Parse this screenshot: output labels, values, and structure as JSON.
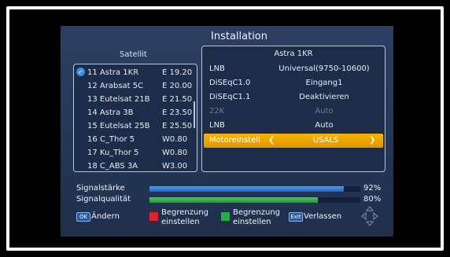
{
  "header": {
    "title": "Installation"
  },
  "satellites": {
    "heading": "Satellit",
    "items": [
      {
        "name": "11 Astra 1KR",
        "position": "E 19.20",
        "checked": true
      },
      {
        "name": "12 Arabsat 5C",
        "position": "E 20.00"
      },
      {
        "name": "13 Eutelsat 21B",
        "position": "E 21.50"
      },
      {
        "name": "14 Astra 3B",
        "position": "E 23.50"
      },
      {
        "name": "15 Eutelsat 25B",
        "position": "E 25.50"
      },
      {
        "name": "16 C_Thor 5",
        "position": "W0.80"
      },
      {
        "name": "17 Ku_Thor 5",
        "position": "W0.80"
      },
      {
        "name": "18 C_ABS 3A",
        "position": "W3.00"
      }
    ]
  },
  "settings": {
    "heading": "Astra 1KR",
    "rows": [
      {
        "label": "LNB",
        "value": "Universal(9750-10600)"
      },
      {
        "label": "DiSEqC1.0",
        "value": "Eingang1"
      },
      {
        "label": "DiSEqC1.1",
        "value": "Deaktivieren"
      },
      {
        "label": "22K",
        "value": "Auto",
        "disabled": true
      },
      {
        "label": "LNB",
        "value": "Auto"
      },
      {
        "label": "Motoreinstell",
        "value": "USALS",
        "selected": true
      }
    ]
  },
  "signal": {
    "strength": {
      "label": "Signalstärke",
      "percent_text": "92%",
      "level": 0.92
    },
    "quality": {
      "label": "Signalqualität",
      "percent_text": "80%",
      "level": 0.8
    }
  },
  "legend": {
    "ok": {
      "key": "OK",
      "label": "Ändern"
    },
    "red": {
      "label_line1": "Begrenzung",
      "label_line2": "einstellen",
      "color": "#e0232b"
    },
    "green": {
      "label_line1": "Begrenzung",
      "label_line2": "einstellen",
      "color": "#23b240"
    },
    "exit": {
      "key": "Exit",
      "label": "Verlassen"
    },
    "nav_icon": "direction-pad-icon"
  },
  "colors": {
    "highlight": "#f6b400",
    "strength_bar": "#2f7fdf",
    "quality_bar": "#2fb347",
    "panel": "#2c3f62"
  }
}
